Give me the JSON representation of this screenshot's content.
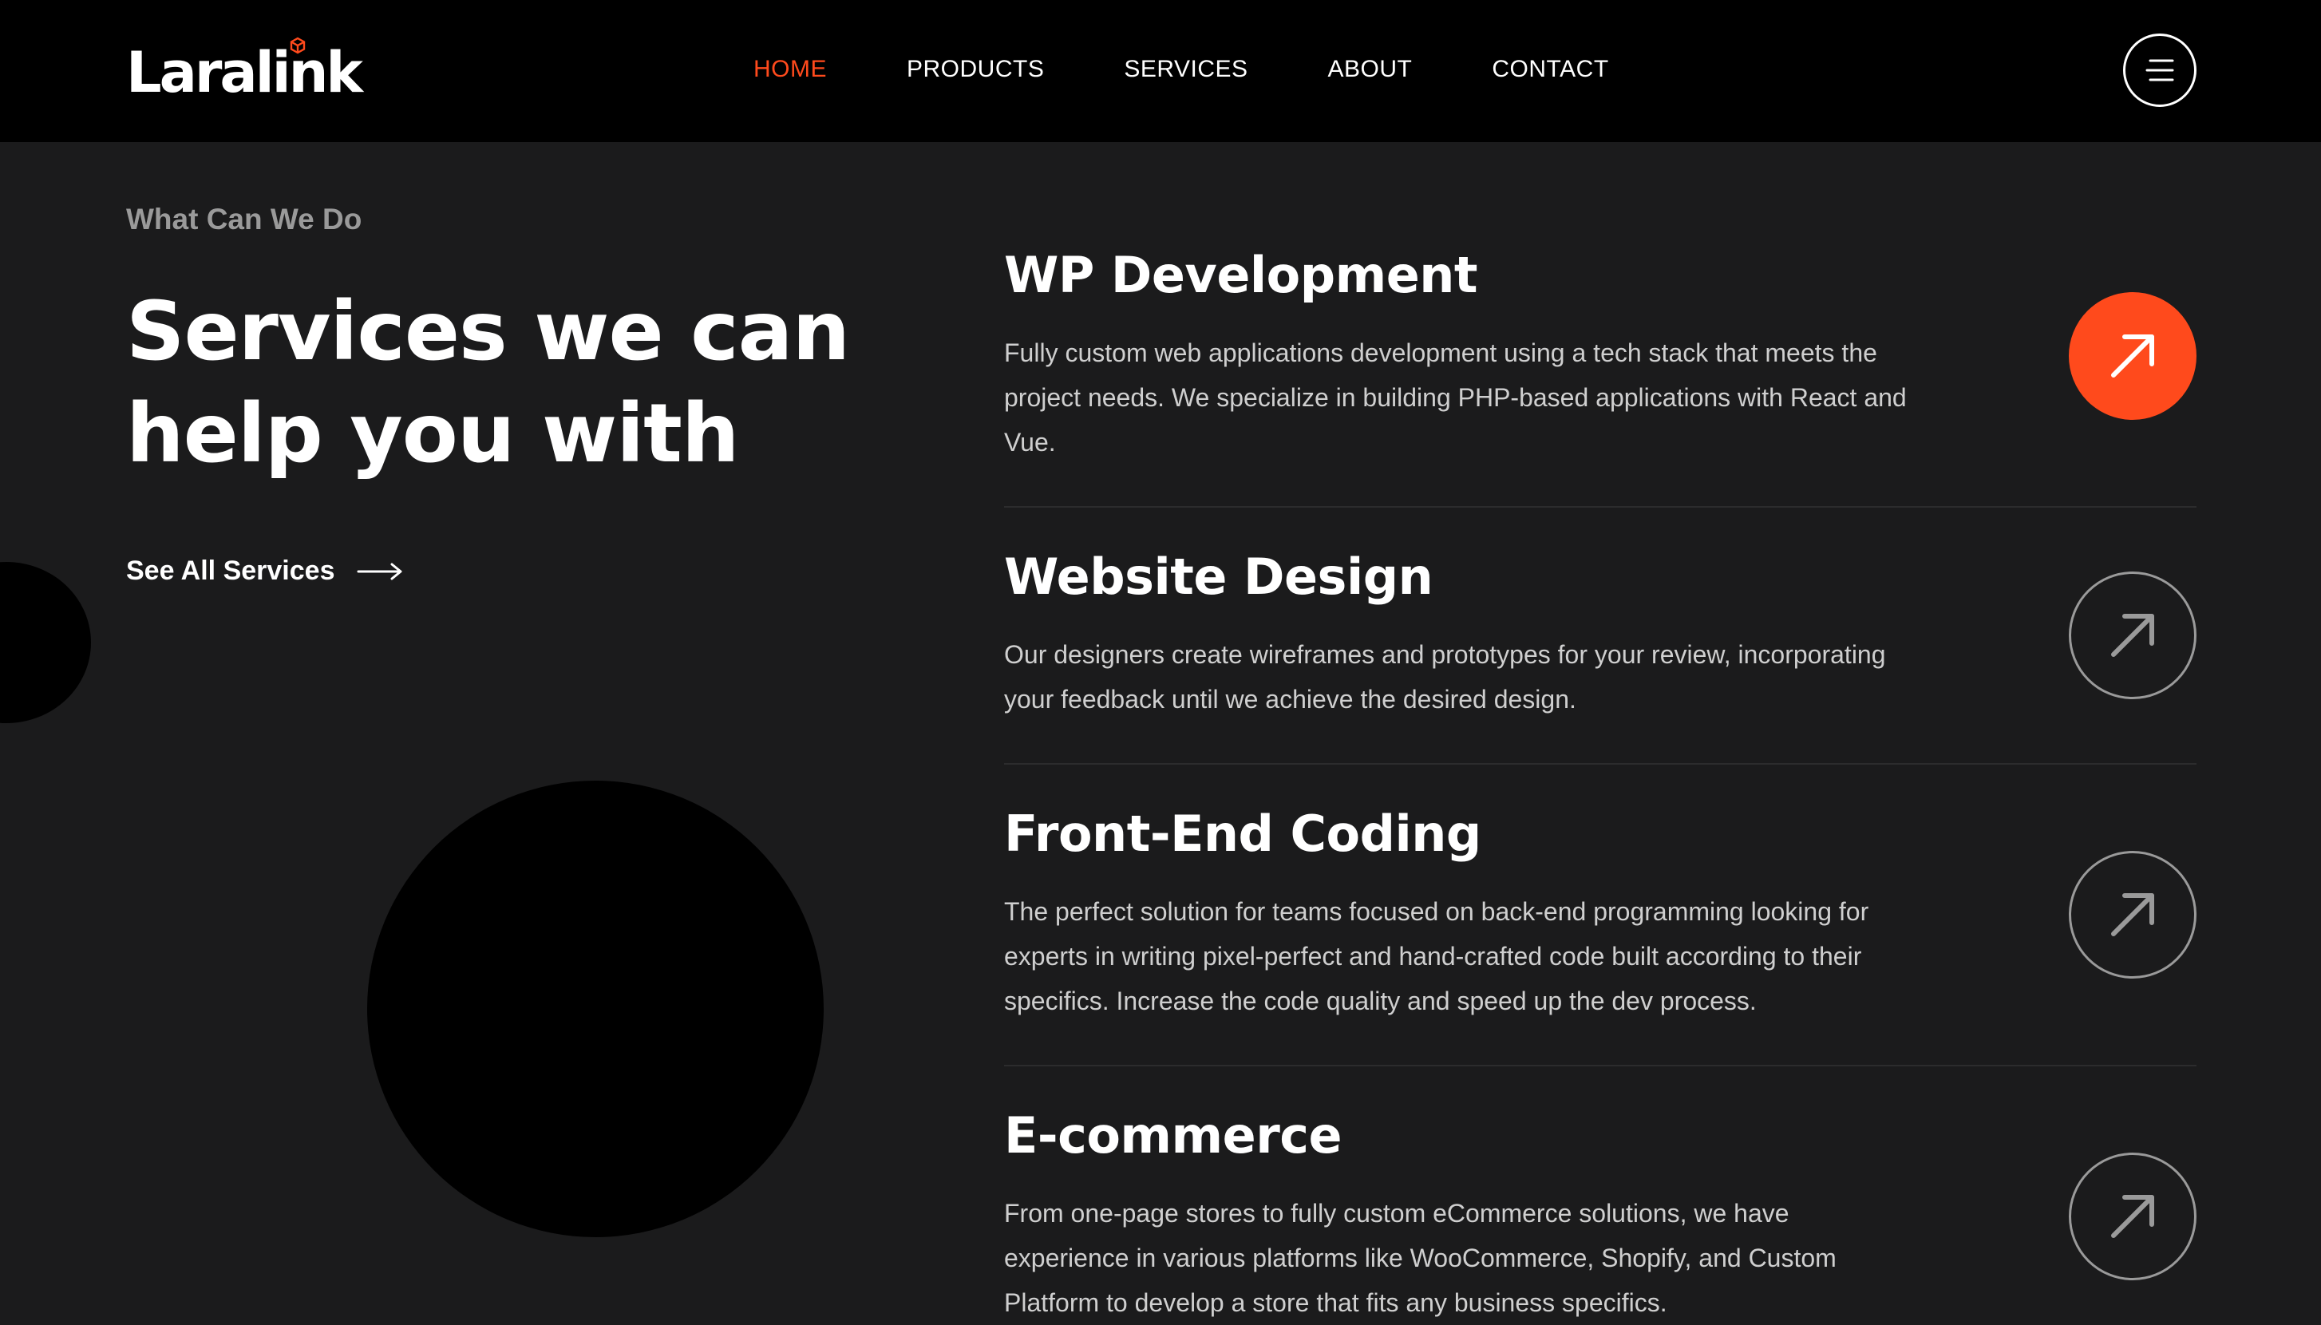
{
  "header": {
    "logo_text": "Laralink",
    "nav": [
      {
        "label": "HOME",
        "active": true
      },
      {
        "label": "PRODUCTS",
        "active": false
      },
      {
        "label": "SERVICES",
        "active": false
      },
      {
        "label": "ABOUT",
        "active": false
      },
      {
        "label": "CONTACT",
        "active": false
      }
    ],
    "menu_icon": "hamburger-menu-icon"
  },
  "intro": {
    "eyebrow": "What Can We Do",
    "title": "Services we can help you with",
    "see_all_label": "See All Services",
    "see_all_icon": "long-arrow-right-icon"
  },
  "services": [
    {
      "title": "WP Development",
      "description": "Fully custom web applications development using a tech stack that meets the project needs. We specialize in building PHP-based applications with React and Vue.",
      "icon": "arrow-up-right-icon",
      "highlighted": true
    },
    {
      "title": "Website Design",
      "description": "Our designers create wireframes and prototypes for your review, incorporating your feedback until we achieve the desired design.",
      "icon": "arrow-up-right-icon",
      "highlighted": false
    },
    {
      "title": "Front-End Coding",
      "description": "The perfect solution for teams focused on back-end programming looking for experts in writing pixel-perfect and hand-crafted code built according to their specifics. Increase the code quality and speed up the dev process.",
      "icon": "arrow-up-right-icon",
      "highlighted": false
    },
    {
      "title": "E-commerce",
      "description": "From one-page stores to fully custom eCommerce solutions, we have experience in various platforms like WooCommerce, Shopify, and Custom Platform to develop a store that fits any business specifics.",
      "icon": "arrow-up-right-icon",
      "highlighted": false
    }
  ],
  "colors": {
    "accent": "#ff4a1c",
    "background": "#1b1b1c",
    "header_background": "#000000",
    "muted_text": "#9a9a9a",
    "body_text": "#cfcfcf"
  }
}
